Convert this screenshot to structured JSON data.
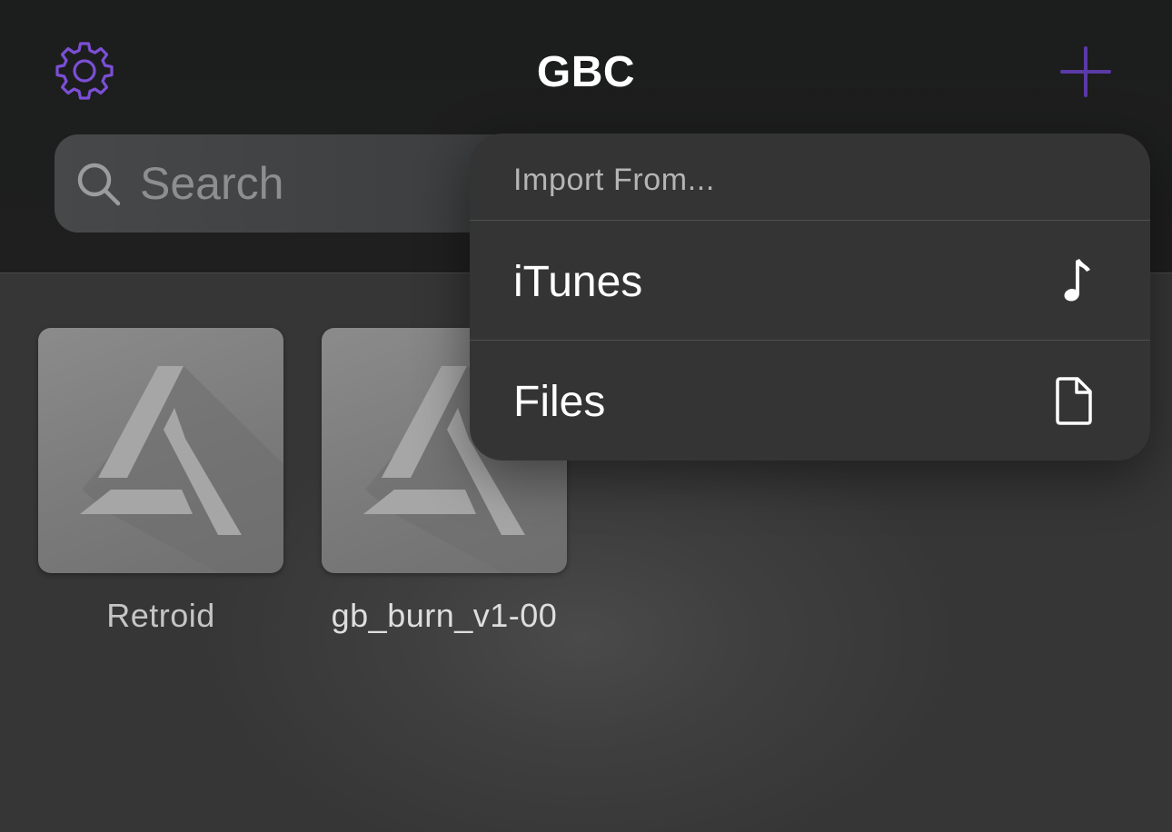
{
  "navbar": {
    "title": "GBC",
    "settings_icon": "gear-icon",
    "add_icon": "plus-icon"
  },
  "search": {
    "placeholder": "Search",
    "icon": "search-icon"
  },
  "games": [
    {
      "name": "Retroid",
      "artwork_icon": "placeholder-logo-icon"
    },
    {
      "name": "gb_burn_v1-00",
      "artwork_icon": "placeholder-logo-icon"
    }
  ],
  "import_menu": {
    "header": "Import From...",
    "items": [
      {
        "label": "iTunes",
        "icon": "music-note-icon"
      },
      {
        "label": "Files",
        "icon": "document-icon"
      }
    ]
  },
  "colors": {
    "accent": "#7b4fd6",
    "navbar_bg": "#1c1d1d",
    "content_bg": "#3a3a3a",
    "menu_bg": "#343434"
  }
}
